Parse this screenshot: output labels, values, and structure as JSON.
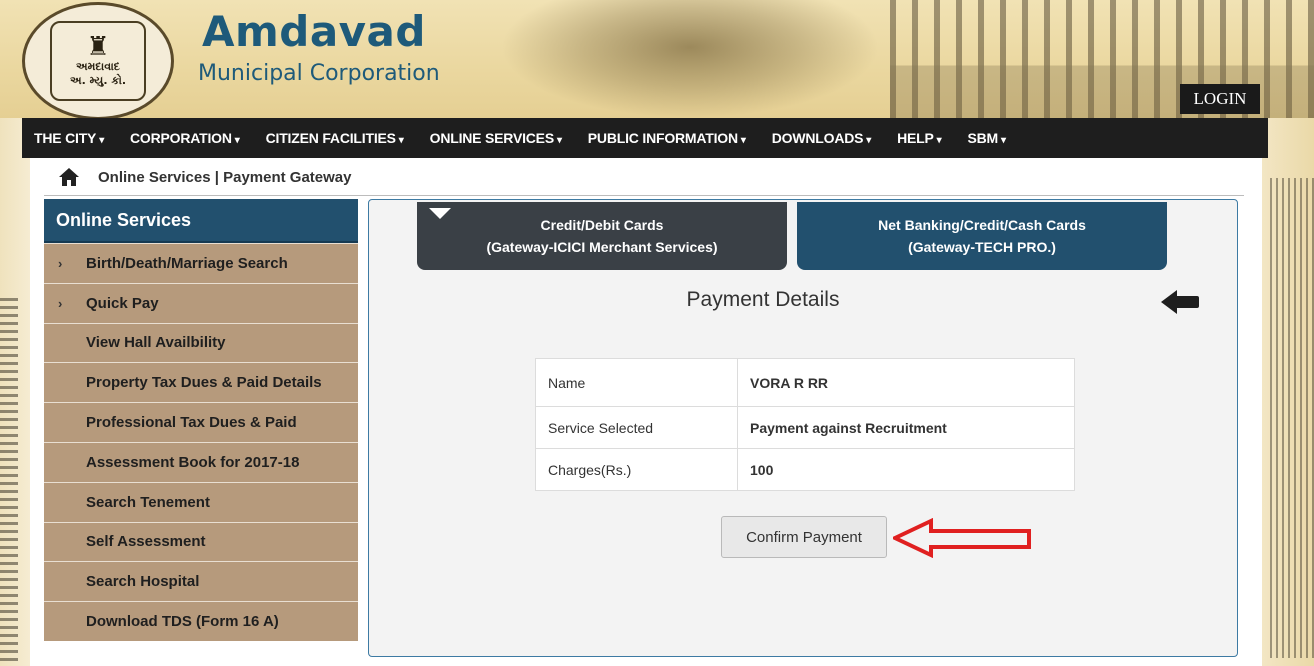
{
  "header": {
    "title": "Amdavad",
    "subtitle": "Municipal Corporation",
    "login_label": "LOGIN",
    "logo_text_top": "અમદાવાદ",
    "logo_text_bottom": "અ. મ્યુ. કો."
  },
  "nav": {
    "items": [
      {
        "label": "THE CITY",
        "caret": "▾"
      },
      {
        "label": "CORPORATION",
        "caret": "▾"
      },
      {
        "label": "CITIZEN FACILITIES",
        "caret": "▾"
      },
      {
        "label": "ONLINE SERVICES",
        "caret": "▾"
      },
      {
        "label": "PUBLIC INFORMATION",
        "caret": "▾"
      },
      {
        "label": "DOWNLOADS",
        "caret": "▾"
      },
      {
        "label": "HELP",
        "caret": "▾"
      },
      {
        "label": "SBM",
        "caret": "▾"
      }
    ]
  },
  "breadcrumb": {
    "text": "Online Services | Payment Gateway",
    "icon": "home-icon"
  },
  "sidebar": {
    "title": "Online Services",
    "items": [
      {
        "label": "Birth/Death/Marriage Search",
        "has_arrow": true
      },
      {
        "label": "Quick Pay",
        "has_arrow": true
      },
      {
        "label": "View Hall Availbility",
        "has_arrow": false
      },
      {
        "label": "Property Tax Dues & Paid Details",
        "has_arrow": false
      },
      {
        "label": "Professional Tax Dues & Paid",
        "has_arrow": false
      },
      {
        "label": "Assessment Book for 2017-18",
        "has_arrow": false
      },
      {
        "label": "Search Tenement",
        "has_arrow": false
      },
      {
        "label": "Self Assessment",
        "has_arrow": false
      },
      {
        "label": "Search Hospital",
        "has_arrow": false
      },
      {
        "label": "Download TDS (Form 16 A)",
        "has_arrow": false
      }
    ]
  },
  "tabs": [
    {
      "line1": "Credit/Debit Cards",
      "line2": "(Gateway-ICICI Merchant Services)",
      "active": true
    },
    {
      "line1": "Net Banking/Credit/Cash Cards",
      "line2": "(Gateway-TECH PRO.)",
      "active": false
    }
  ],
  "payment": {
    "title": "Payment Details",
    "rows": [
      {
        "label": "Name",
        "value": "VORA R RR"
      },
      {
        "label": "Service Selected",
        "value": "Payment against Recruitment"
      },
      {
        "label": "Charges(Rs.)",
        "value": "100"
      }
    ],
    "confirm_label": "Confirm Payment"
  },
  "colors": {
    "nav_bg": "#1e1e1e",
    "sidebar_header": "#22506e",
    "sidebar_item": "#b69a7c",
    "tab_active": "#3a4046",
    "tab_inactive": "#22506e",
    "title_blue": "#1e5a7a",
    "annotation_arrow": "#e02020"
  }
}
